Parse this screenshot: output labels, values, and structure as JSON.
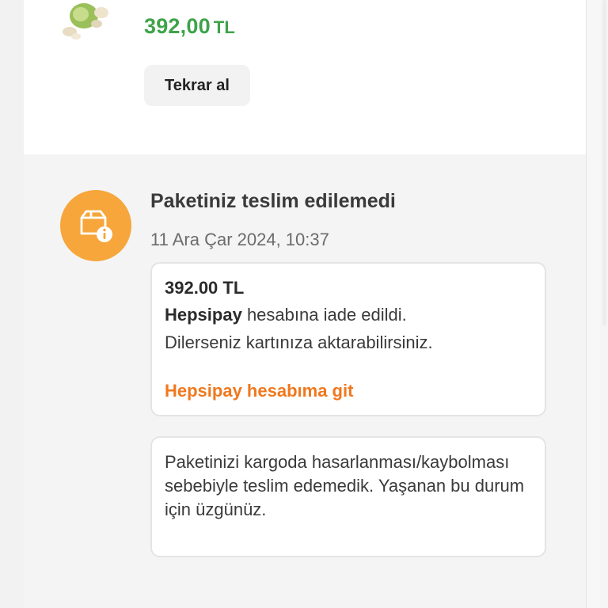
{
  "product": {
    "price": "392,00",
    "currency": "TL",
    "rebuy_label": "Tekrar al"
  },
  "status": {
    "title": "Paketiniz teslim edilemedi",
    "date": "11 Ara Çar 2024, 10:37",
    "icon": "package-info-icon"
  },
  "refund": {
    "amount": "392.00 TL",
    "wallet_name": "Hepsipay",
    "line1_rest": " hesabına iade edildi.",
    "line2": "Dilerseniz kartınıza aktarabilirsiniz.",
    "link_label": "Hepsipay hesabıma git"
  },
  "message": {
    "text": "Paketinizi kargoda hasarlanması/kaybolması sebebiyle teslim edemedik. Yaşanan bu durum için üzgünüz."
  },
  "colors": {
    "price_green": "#3ea34a",
    "status_orange": "#f6a63b",
    "link_orange": "#f0781e"
  }
}
